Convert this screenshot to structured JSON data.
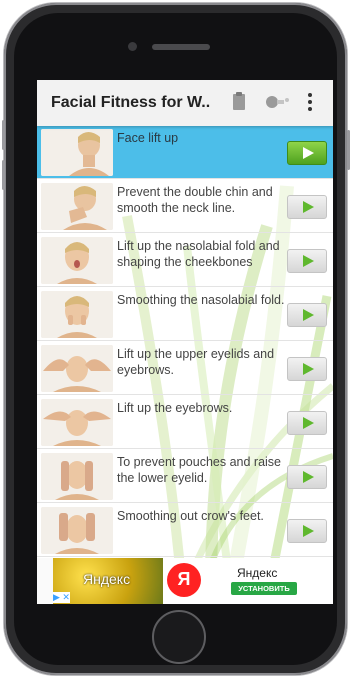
{
  "app": {
    "title": "Facial Fitness for W...",
    "icons": [
      "clipboard-icon",
      "toggle-icon",
      "more-vert-icon"
    ]
  },
  "exercises": [
    {
      "label": "Face lift up",
      "selected": true
    },
    {
      "label": "Prevent the double chin and smooth the neck line.",
      "selected": false
    },
    {
      "label": "Lift up the nasolabial fold and shaping the cheekbones",
      "selected": false
    },
    {
      "label": "Smoothing the nasolabial fold.",
      "selected": false
    },
    {
      "label": "Lift up the upper eyelids and eyebrows.",
      "selected": false
    },
    {
      "label": "Lift up the eyebrows.",
      "selected": false
    },
    {
      "label": "To prevent pouches and raise the lower eyelid.",
      "selected": false
    },
    {
      "label": "Smoothing out crow's feet.",
      "selected": false
    }
  ],
  "ad": {
    "brand_left": "Яндекс",
    "logo_letter": "Я",
    "name": "Яндекс",
    "install_label": "УСТАНОВИТЬ",
    "info": "▶ ✕"
  },
  "colors": {
    "selected_row": "#42bbe8",
    "play_active": "#5fb82e",
    "appbar": "#f2f2f2"
  }
}
